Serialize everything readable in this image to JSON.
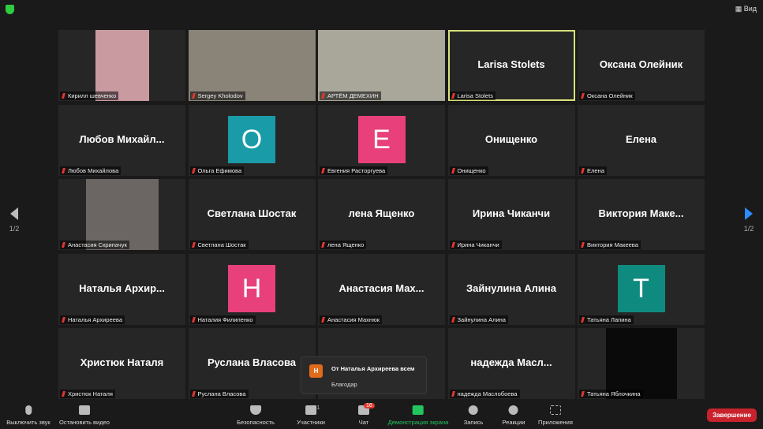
{
  "header": {
    "view_label": "Вид"
  },
  "pagination": {
    "left": "1/2",
    "right": "1/2"
  },
  "tiles": [
    {
      "name": "Кирилл шевченко",
      "type": "video",
      "video_color": "#c99aa0"
    },
    {
      "name": "Sergey Kholodov",
      "type": "video",
      "video_color": "#8a8378"
    },
    {
      "name": "АРТЁМ ДЕМЕХИН",
      "type": "video",
      "video_color": "#a9a69a"
    },
    {
      "name": "Larisa Stolets",
      "type": "text",
      "display": "Larisa Stolets",
      "active": true
    },
    {
      "name": "Оксана Олейник",
      "type": "text",
      "display": "Оксана Олейник"
    },
    {
      "name": "Любов Михайлова",
      "type": "text",
      "display": "Любов  Михайл..."
    },
    {
      "name": "Ольга Ефимова",
      "type": "avatar",
      "initial": "O",
      "color": "#1a9ba8"
    },
    {
      "name": "Евгения Расторгуева",
      "type": "avatar",
      "initial": "E",
      "color": "#e8407a"
    },
    {
      "name": "Онищенко",
      "type": "text",
      "display": "Онищенко"
    },
    {
      "name": "Елена",
      "type": "text",
      "display": "Елена"
    },
    {
      "name": "Анастасия Скрипачук",
      "type": "video",
      "video_color": "#6b6663"
    },
    {
      "name": "Светлана Шостак",
      "type": "text",
      "display": "Светлана Шостак"
    },
    {
      "name": "лена Ященко",
      "type": "text",
      "display": "лена Ященко"
    },
    {
      "name": "Ирина Чиканчи",
      "type": "text",
      "display": "Ирина Чиканчи"
    },
    {
      "name": "Виктория Макеева",
      "type": "text",
      "display": "Виктория  Маке..."
    },
    {
      "name": "Наталья Архиреева",
      "type": "text",
      "display": "Наталья  Архир..."
    },
    {
      "name": "Наталия Филипенко",
      "type": "avatar",
      "initial": "H",
      "color": "#e8407a"
    },
    {
      "name": "Анастасия Махнюк",
      "type": "text",
      "display": "Анастасия  Мах..."
    },
    {
      "name": "Зайнулина Алина",
      "type": "text",
      "display": "Зайнулина Алина"
    },
    {
      "name": "Татьяна Лапина",
      "type": "avatar",
      "initial": "T",
      "color": "#0f8a7e"
    },
    {
      "name": "Христюк Наталя",
      "type": "text",
      "display": "Христюк Наталя"
    },
    {
      "name": "Руслана Власова",
      "type": "text",
      "display": "Руслана Власова"
    },
    {
      "name": "",
      "type": "text",
      "display": ""
    },
    {
      "name": "надежда Маслобоева",
      "type": "text",
      "display": "надежда  Масл..."
    },
    {
      "name": "Татьяна Яблочкина",
      "type": "video",
      "video_color": "#0a0a0a"
    }
  ],
  "chat_popup": {
    "initial": "Н",
    "from": "От Наталья Архиреева всем",
    "message": "Благодар"
  },
  "toolbar": {
    "mute": "Выключить звук",
    "video": "Остановить видео",
    "security": "Безопасность",
    "participants": "Участники",
    "participants_count": "31",
    "chat": "Чат",
    "chat_badge": "16",
    "share": "Демонстрация экрана",
    "record": "Запись",
    "reactions": "Реакции",
    "apps": "Приложения",
    "end": "Завершение"
  }
}
